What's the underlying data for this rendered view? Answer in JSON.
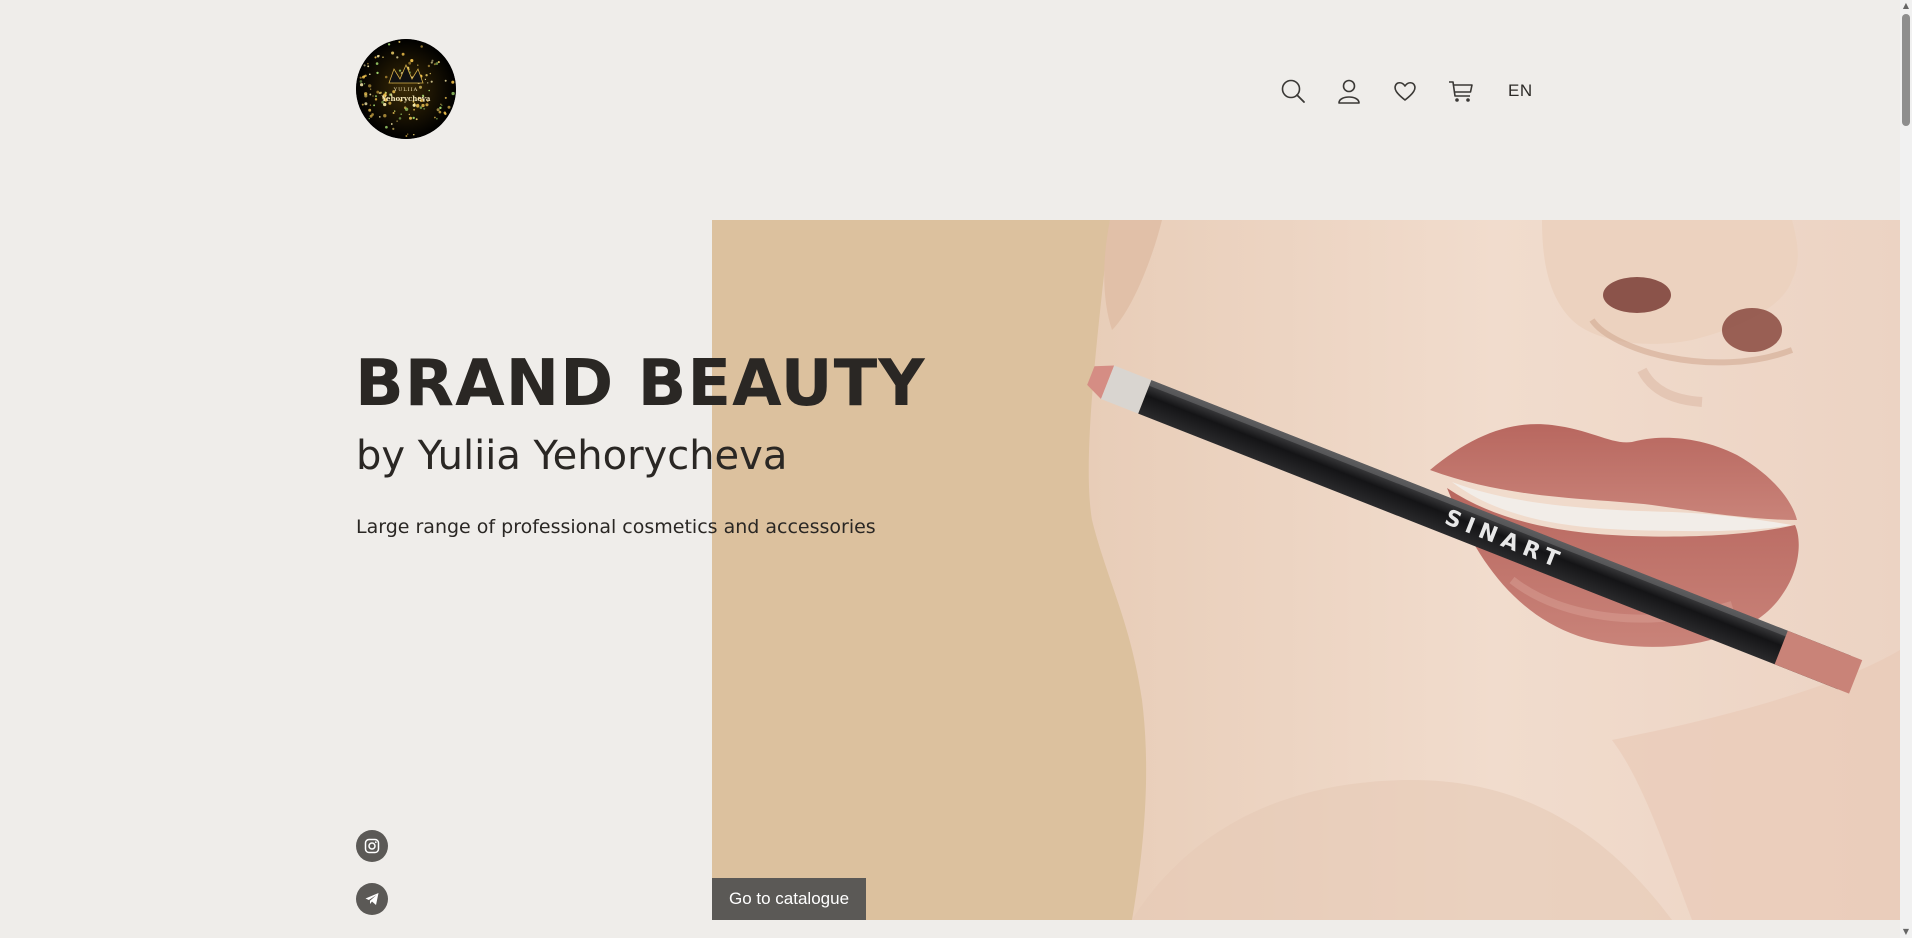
{
  "logo": {
    "line1": "YULIIA",
    "line2": "Yehorycheva"
  },
  "header": {
    "icons": [
      "search-icon",
      "user-icon",
      "heart-icon",
      "cart-icon"
    ],
    "language": "EN"
  },
  "hero": {
    "title": "BRAND BEAUTY",
    "subtitle": "by Yuliia Yehorycheva",
    "description": "Large range of professional cosmetics and accessories",
    "cta_label": "Go to catalogue",
    "pencil_brand": "SINART"
  },
  "social": [
    "instagram-icon",
    "telegram-icon"
  ],
  "colors": {
    "background": "#efedea",
    "text": "#2a2724",
    "button": "#5b5956",
    "beige": "#dcc19e",
    "lip": "#c07a72"
  }
}
